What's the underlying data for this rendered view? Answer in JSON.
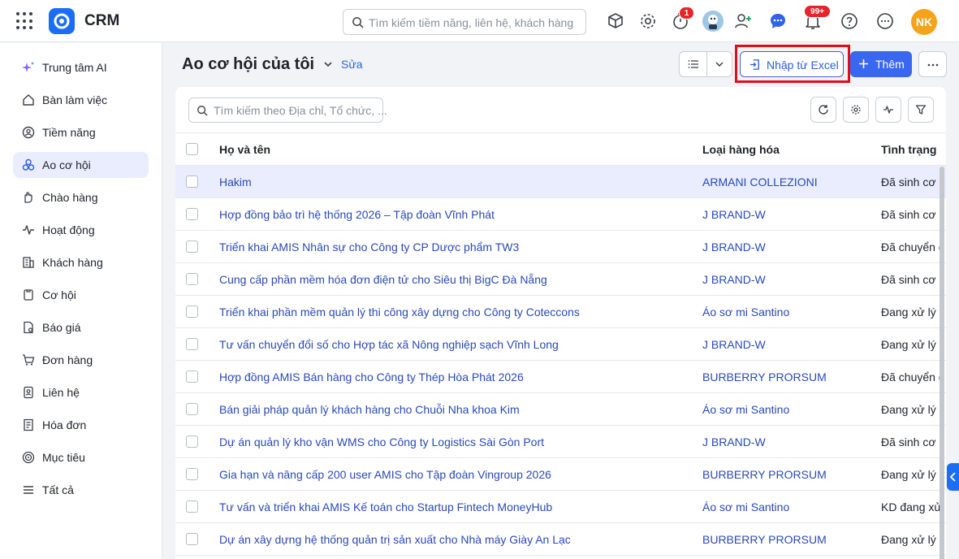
{
  "app": {
    "name": "CRM",
    "search_placeholder": "Tìm kiếm tiềm năng, liên hệ, khách hàng",
    "timer_badge": "1",
    "bell_badge": "99+",
    "avatar_initials": "NK",
    "accent": "#1b6ef3"
  },
  "sidebar": {
    "items": [
      {
        "label": "Trung tâm AI",
        "icon": "ai-sparkle-icon"
      },
      {
        "label": "Bàn làm việc",
        "icon": "home-icon"
      },
      {
        "label": "Tiềm năng",
        "icon": "lead-icon"
      },
      {
        "label": "Ao cơ hội",
        "icon": "pool-icon"
      },
      {
        "label": "Chào hàng",
        "icon": "offer-icon"
      },
      {
        "label": "Hoạt động",
        "icon": "activity-icon"
      },
      {
        "label": "Khách hàng",
        "icon": "building-icon"
      },
      {
        "label": "Cơ hội",
        "icon": "opportunity-icon"
      },
      {
        "label": "Báo giá",
        "icon": "quote-icon"
      },
      {
        "label": "Đơn hàng",
        "icon": "cart-icon"
      },
      {
        "label": "Liên hệ",
        "icon": "contact-icon"
      },
      {
        "label": "Hóa đơn",
        "icon": "invoice-icon"
      },
      {
        "label": "Mục tiêu",
        "icon": "target-icon"
      },
      {
        "label": "Tất cả",
        "icon": "menu-icon"
      }
    ],
    "active": "Ao cơ hội"
  },
  "page": {
    "title": "Ao cơ hội của tôi",
    "edit_label": "Sửa",
    "import_label": "Nhập từ Excel",
    "add_label": "Thêm"
  },
  "list": {
    "search_placeholder": "Tìm kiếm theo Địa chỉ, Tổ chức, ...",
    "columns": [
      "Họ và tên",
      "Loại hàng hóa",
      "Tình trạng"
    ],
    "rows": [
      {
        "name": "Hakim",
        "product": "ARMANI COLLEZIONI",
        "status": "Đã sinh cơ hội"
      },
      {
        "name": "Hợp đồng bảo trì hệ thống 2026 – Tập đoàn Vĩnh Phát",
        "product": "J BRAND-W",
        "status": "Đã sinh cơ hội"
      },
      {
        "name": "Triển khai AMIS Nhân sự cho Công ty CP Dược phẩm TW3",
        "product": "J BRAND-W",
        "status": "Đã chuyển đổi"
      },
      {
        "name": "Cung cấp phần mềm hóa đơn điện tử cho Siêu thị BigC Đà Nẵng",
        "product": "J BRAND-W",
        "status": "Đã sinh cơ hội"
      },
      {
        "name": "Triển khai phần mềm quản lý thi công xây dựng cho Công ty Coteccons",
        "product": "Áo sơ mi Santino",
        "status": "Đang xử lý"
      },
      {
        "name": "Tư vấn chuyển đổi số cho Hợp tác xã Nông nghiệp sạch Vĩnh Long",
        "product": "J BRAND-W",
        "status": "Đang xử lý"
      },
      {
        "name": "Hợp đồng AMIS Bán hàng cho Công ty Thép Hòa Phát 2026",
        "product": "BURBERRY PRORSUM",
        "status": "Đã chuyển đổi"
      },
      {
        "name": "Bán giải pháp quản lý khách hàng cho Chuỗi Nha khoa Kim",
        "product": "Áo sơ mi Santino",
        "status": "Đang xử lý"
      },
      {
        "name": "Dự án quản lý kho vận WMS cho Công ty Logistics Sài Gòn Port",
        "product": "J BRAND-W",
        "status": "Đã sinh cơ hội"
      },
      {
        "name": "Gia hạn và nâng cấp 200 user AMIS cho Tập đoàn Vingroup 2026",
        "product": "BURBERRY PRORSUM",
        "status": "Đang xử lý"
      },
      {
        "name": "Tư vấn và triển khai AMIS Kế toán cho Startup Fintech MoneyHub",
        "product": "Áo sơ mi Santino",
        "status": "KD đang xử lý"
      },
      {
        "name": "Dự án xây dựng hệ thống quản trị sản xuất cho Nhà máy Giày An Lạc",
        "product": "BURBERRY PRORSUM",
        "status": "Đang xử lý"
      }
    ]
  }
}
